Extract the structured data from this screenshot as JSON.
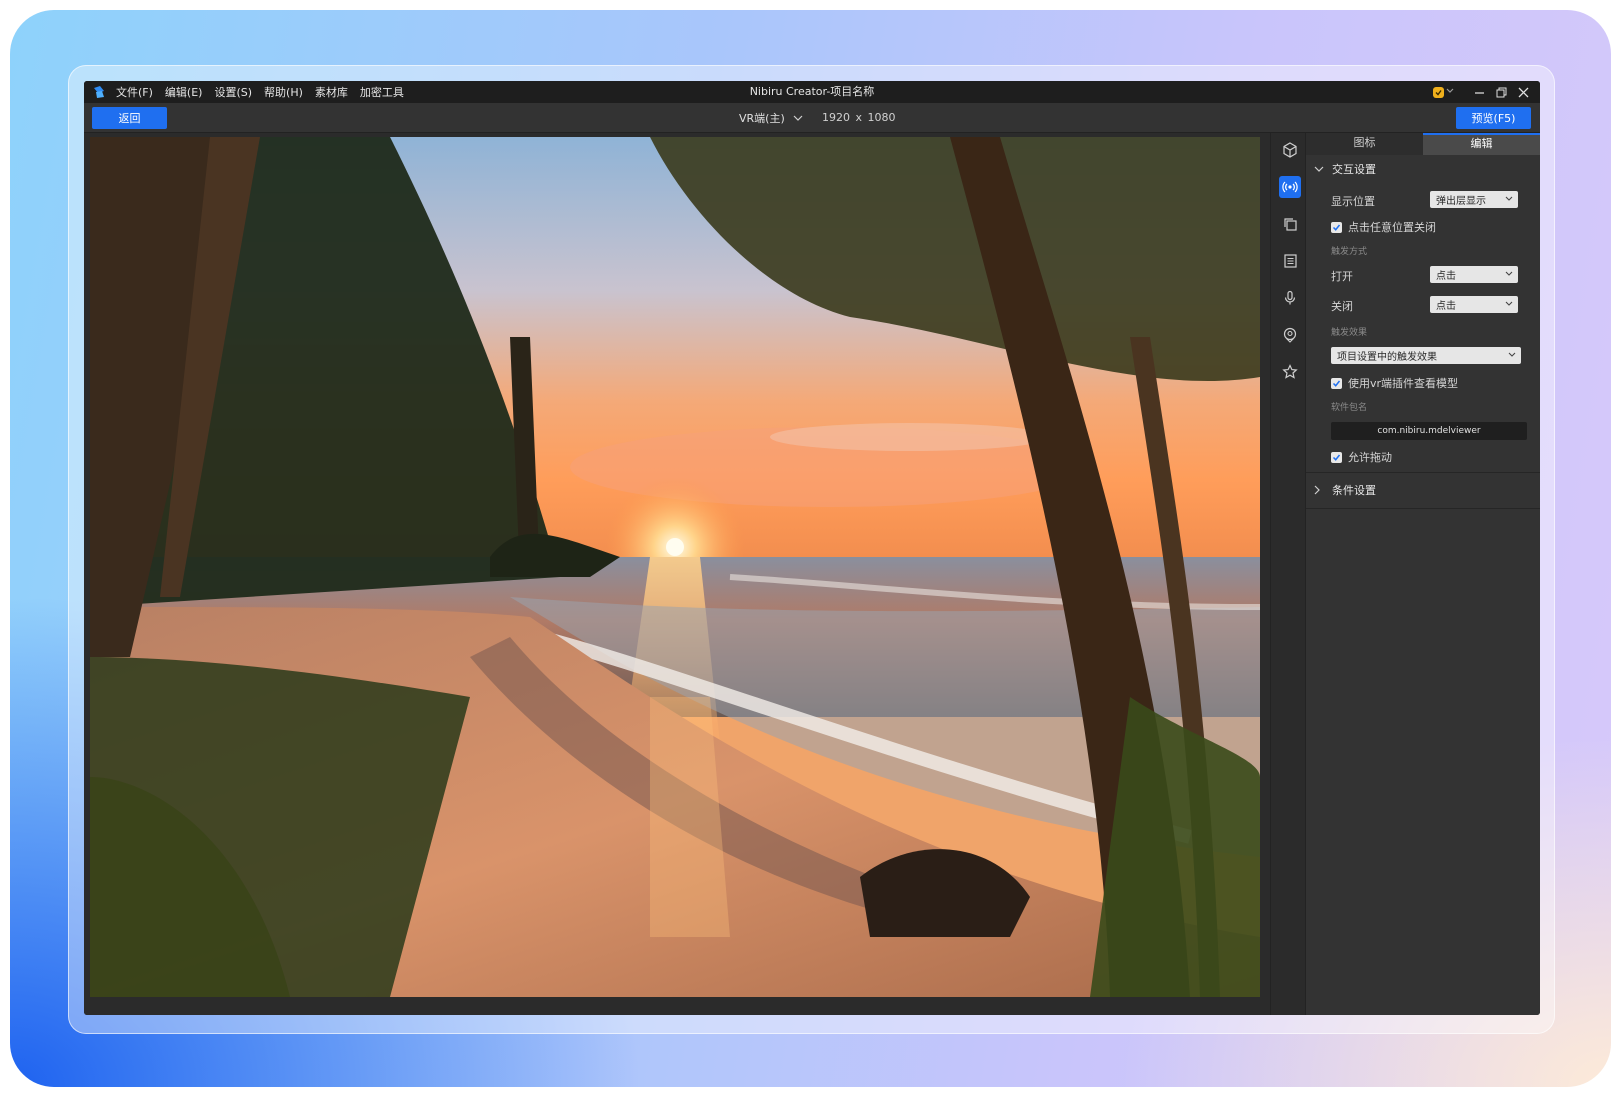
{
  "app": {
    "title": "Nibiru Creator-项目名称",
    "menu": [
      "文件(F)",
      "编辑(E)",
      "设置(S)",
      "帮助(H)",
      "素材库",
      "加密工具"
    ]
  },
  "toolbar": {
    "back_label": "返回",
    "device": "VR端(主)",
    "resolution": "1920 x 1080",
    "preview_label": "预览(F5)"
  },
  "colors": {
    "accent": "#1f6ff0",
    "window_bg": "#2b2b2b",
    "panel_bg": "#333333",
    "warning": "#f0b01c"
  },
  "icon_rail": [
    {
      "name": "cube-icon",
      "active": false
    },
    {
      "name": "broadcast-icon",
      "active": true
    },
    {
      "name": "layers-icon",
      "active": false
    },
    {
      "name": "document-list-icon",
      "active": false
    },
    {
      "name": "microphone-icon",
      "active": false
    },
    {
      "name": "location-icon",
      "active": false
    },
    {
      "name": "star-settings-icon",
      "active": false
    }
  ],
  "panel": {
    "tabs": [
      "图标",
      "编辑"
    ],
    "active_tab": "编辑",
    "interaction": {
      "title": "交互设置",
      "display_position_label": "显示位置",
      "display_position_value": "弹出层显示",
      "click_close_label": "点击任意位置关闭",
      "click_close_checked": true,
      "trigger_mode_label": "触发方式",
      "open_label": "打开",
      "open_value": "点击",
      "close_label": "关闭",
      "close_value": "点击",
      "trigger_effect_label": "触发效果",
      "trigger_effect_value": "项目设置中的触发效果",
      "use_vr_plugin_label": "使用vr端插件查看模型",
      "use_vr_plugin_checked": true,
      "package_label": "软件包名",
      "package_value": "com.nibiru.mdelviewer",
      "allow_drag_label": "允许拖动",
      "allow_drag_checked": true
    },
    "condition": {
      "title": "条件设置"
    }
  }
}
